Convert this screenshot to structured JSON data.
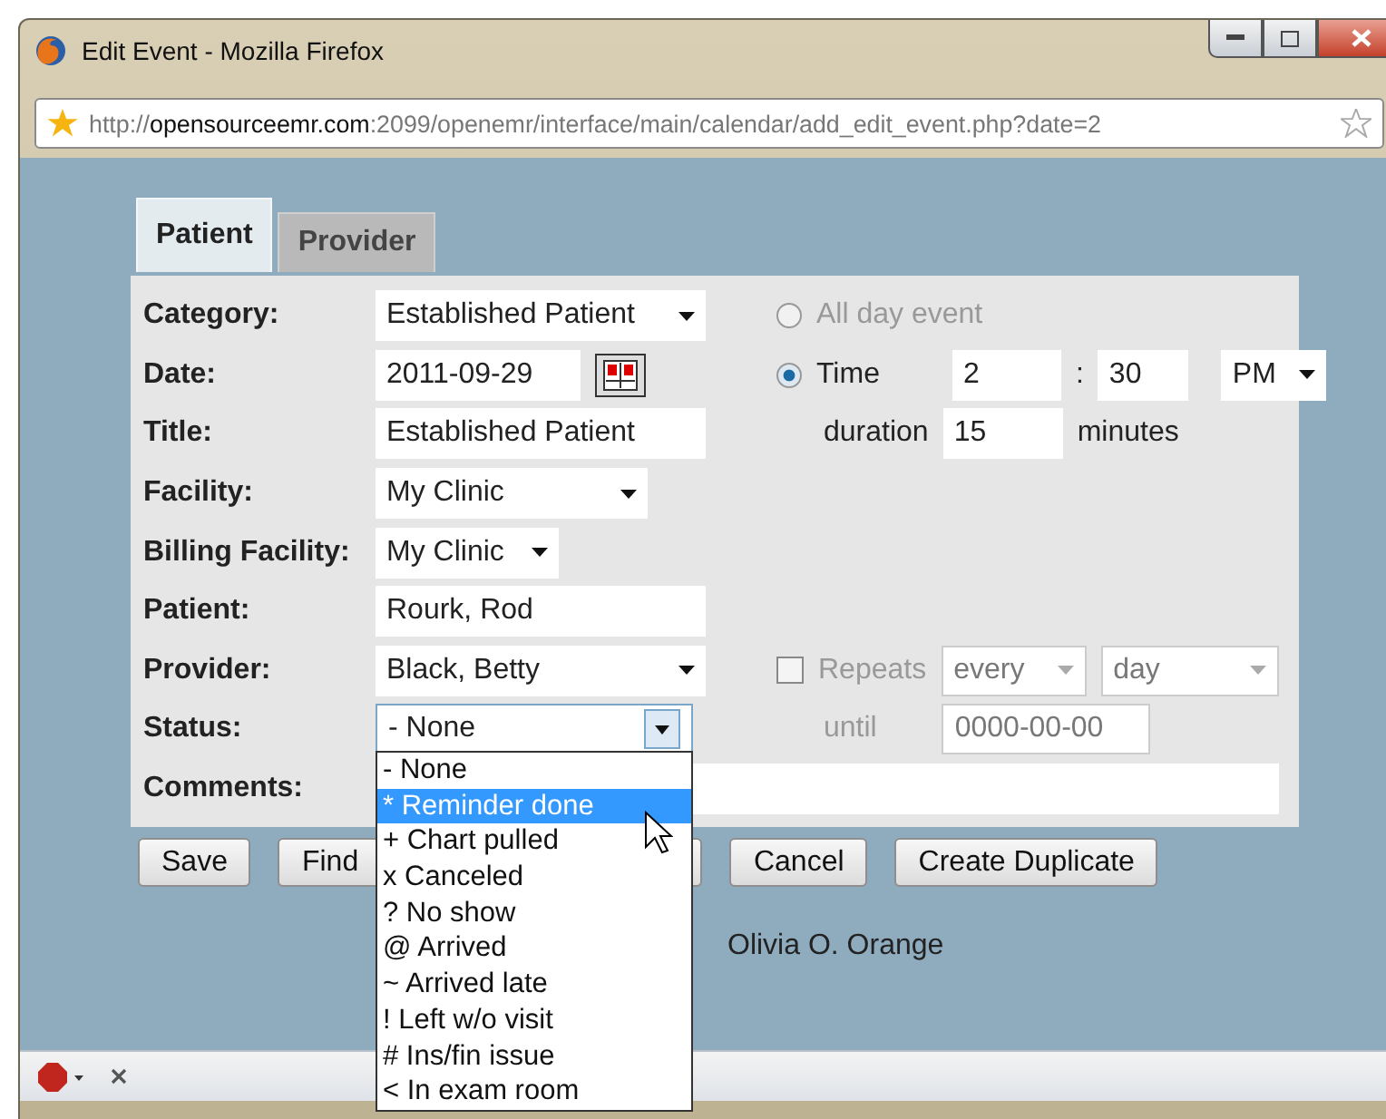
{
  "window": {
    "title": "Edit Event - Mozilla Firefox"
  },
  "address_bar": {
    "url": "http://**opensourceemr.com**:2099/openemr/interface/main/calendar/add_edit_event.php?date=2"
  },
  "tabs": [
    {
      "label": "Patient",
      "selected": true
    },
    {
      "label": "Provider",
      "selected": false
    }
  ],
  "form": {
    "category": {
      "label": "Category:",
      "value": "Established Patient"
    },
    "date": {
      "label": "Date:",
      "value": "2011-09-29"
    },
    "title": {
      "label": "Title:",
      "value": "Established Patient"
    },
    "facility": {
      "label": "Facility:",
      "value": "My Clinic"
    },
    "billing_facility": {
      "label": "Billing Facility:",
      "value": "My Clinic"
    },
    "patient": {
      "label": "Patient:",
      "value": "Rourk, Rod"
    },
    "provider": {
      "label": "Provider:",
      "value": "Black, Betty"
    },
    "status": {
      "label": "Status:",
      "value": "- None"
    },
    "comments": {
      "label": "Comments:"
    },
    "event_type": [
      {
        "label": "All day event",
        "selected": false,
        "disabled": true
      },
      {
        "label": "Time",
        "selected": true,
        "disabled": false
      }
    ],
    "hour": "2",
    "separator": ":",
    "minute": "30",
    "ampm": "PM",
    "duration": {
      "label": "duration",
      "value": "15",
      "unit": "minutes"
    },
    "repeats": {
      "label": "Repeats",
      "checked": false,
      "disabled": true,
      "every": "every",
      "period": "day"
    },
    "until": {
      "label": "until",
      "value": "0000-00-00"
    }
  },
  "buttons": [
    {
      "label": "Save"
    },
    {
      "label": "Find"
    },
    {
      "label": "Cancel"
    },
    {
      "label": "Create Duplicate"
    }
  ],
  "provider_note": "Olivia O. Orange",
  "status_dropdown": [
    {
      "label": "- None",
      "selected": false
    },
    {
      "label": "* Reminder done",
      "selected": true
    },
    {
      "label": "+ Chart pulled",
      "selected": false
    },
    {
      "label": "x Canceled",
      "selected": false
    },
    {
      "label": "? No show",
      "selected": false
    },
    {
      "label": "@ Arrived",
      "selected": false
    },
    {
      "label": "~ Arrived late",
      "selected": false
    },
    {
      "label": "! Left w/o visit",
      "selected": false
    },
    {
      "label": "# Ins/fin issue",
      "selected": false
    },
    {
      "label": "< In exam room",
      "selected": false
    }
  ]
}
